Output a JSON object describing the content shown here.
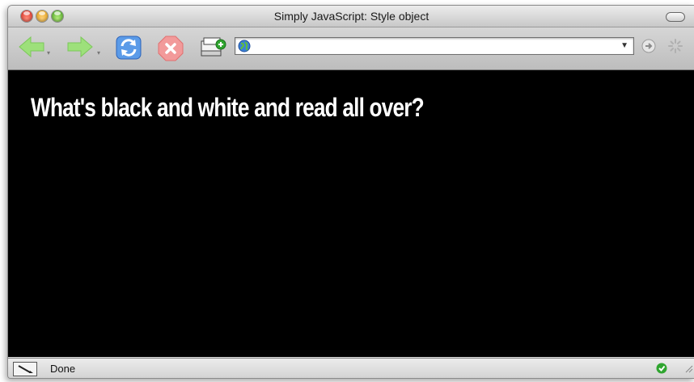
{
  "window": {
    "title": "Simply JavaScript: Style object"
  },
  "toolbar": {
    "back": "back-arrow-icon",
    "forward": "forward-arrow-icon",
    "reload": "reload-icon",
    "stop": "stop-icon",
    "home": "new-tab-page-icon",
    "url": "",
    "url_placeholder": ""
  },
  "content": {
    "heading": "What's black and white and read all over?",
    "background_color": "#000000",
    "text_color": "#ffffff"
  },
  "status": {
    "text": "Done"
  },
  "colors": {
    "back_forward": "#8fd96a",
    "reload": "#3f7fd6",
    "stop": "#f08a8a",
    "ok": "#2fa52f"
  }
}
